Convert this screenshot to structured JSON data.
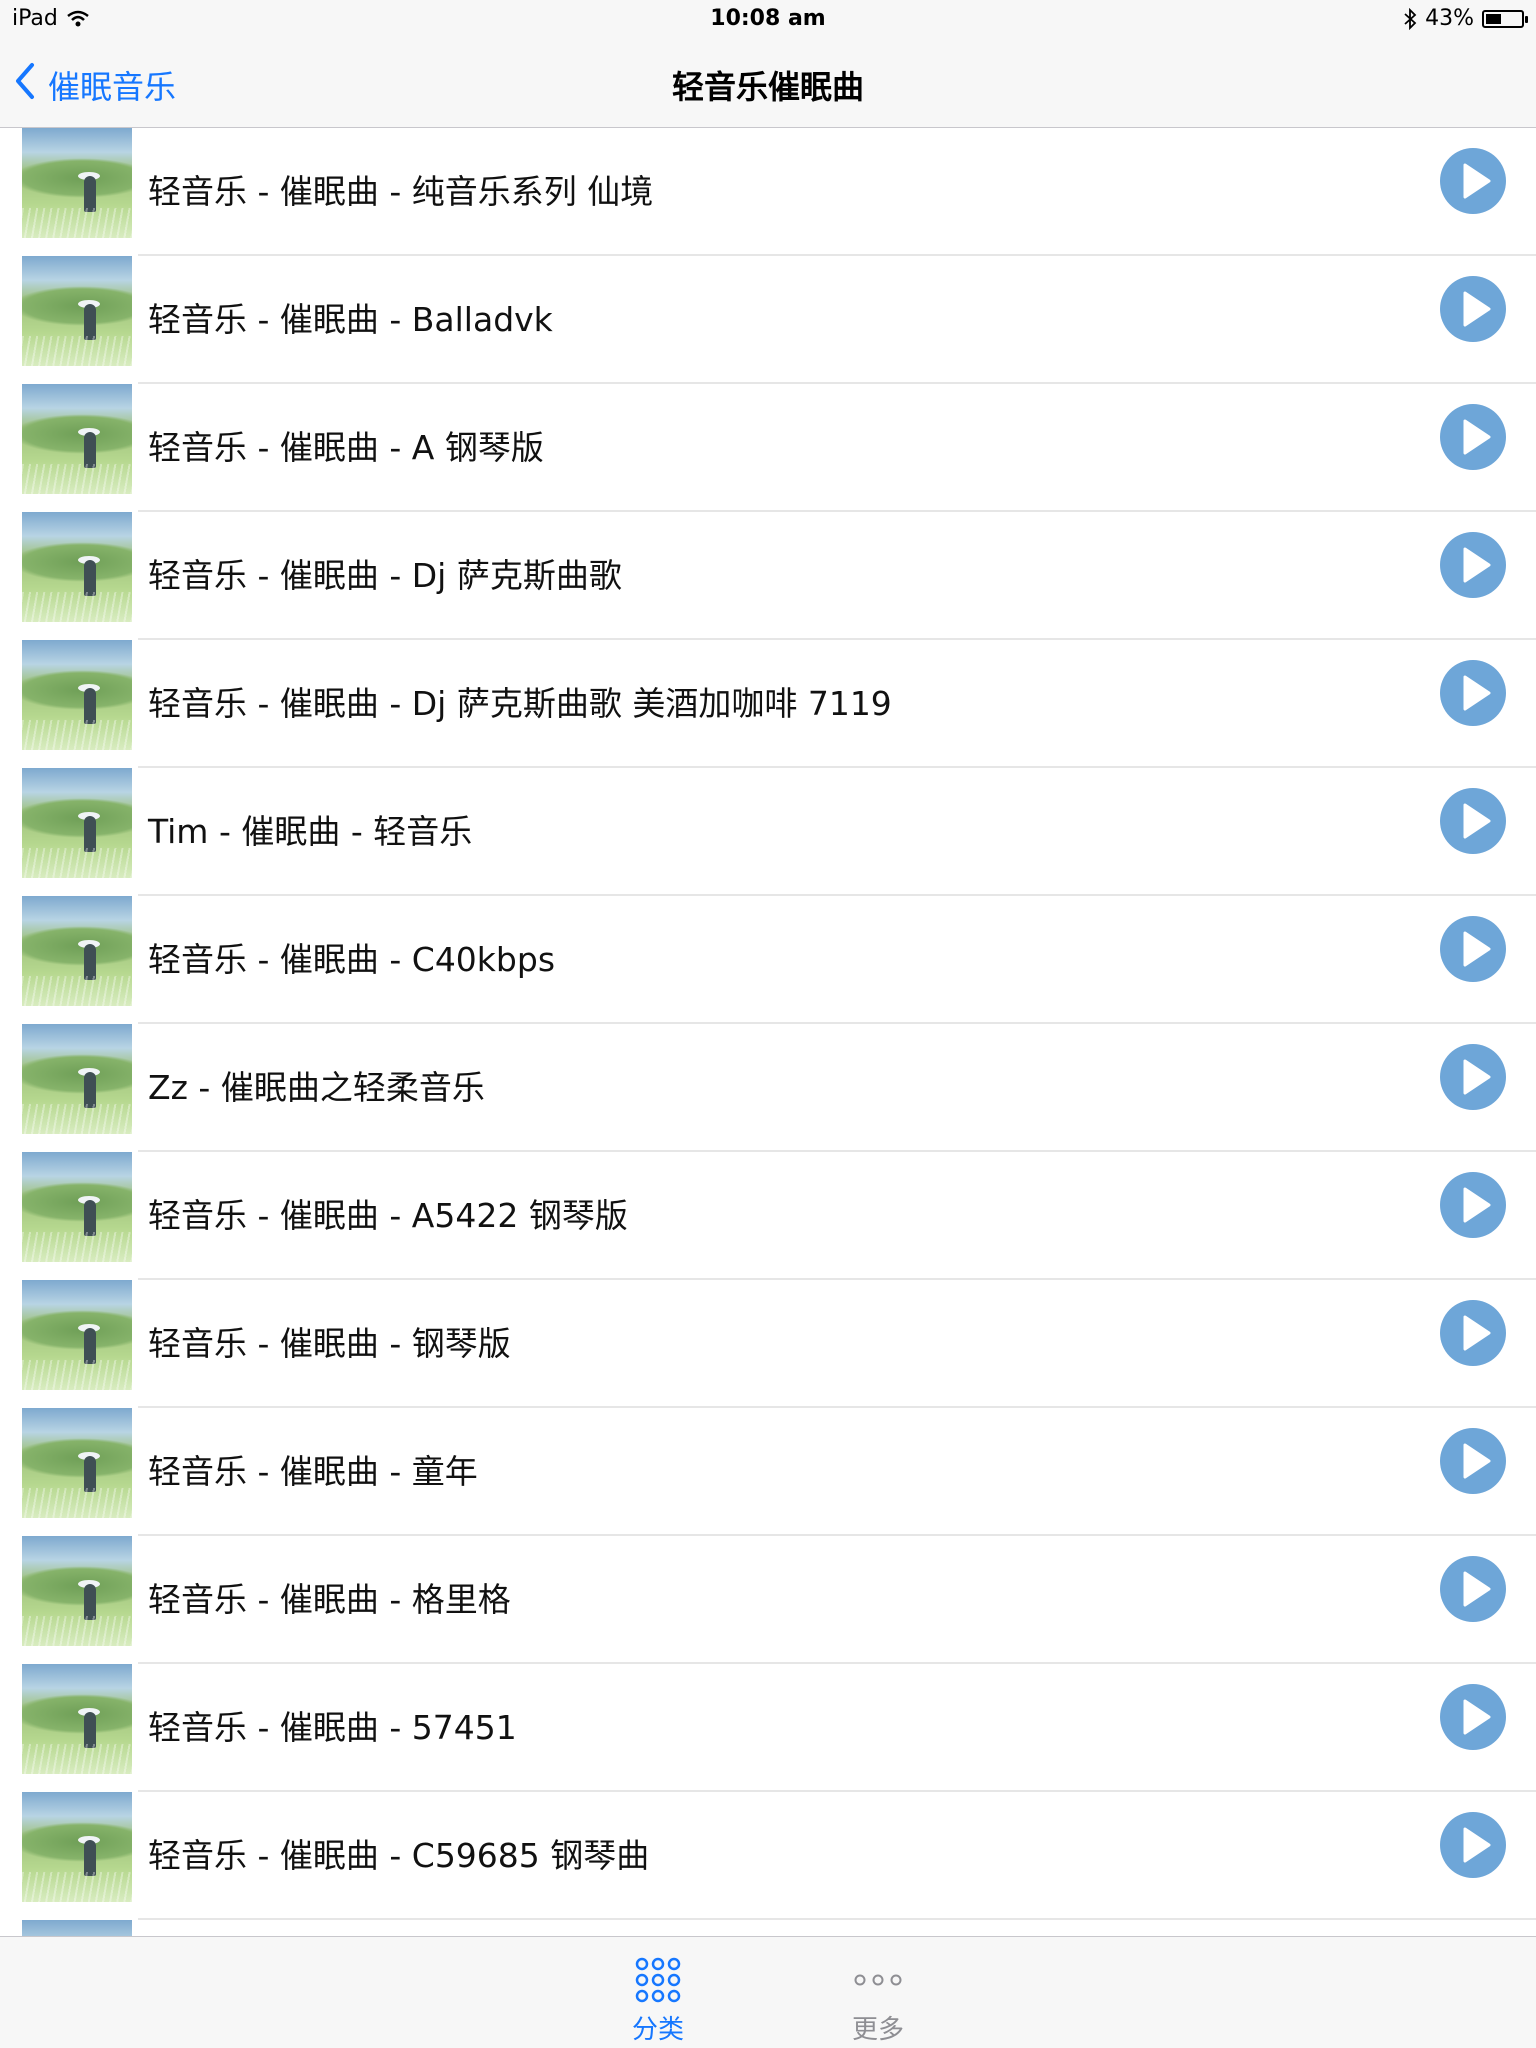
{
  "status_bar": {
    "device": "iPad",
    "time": "10:08 am",
    "battery": "43%",
    "battery_level": 0.43
  },
  "nav": {
    "back_label": "催眠音乐",
    "title": "轻音乐催眠曲"
  },
  "tracks": [
    {
      "title": "轻音乐 - 催眠曲 - 纯音乐系列 仙境"
    },
    {
      "title": "轻音乐 - 催眠曲 - Balladvk"
    },
    {
      "title": "轻音乐 - 催眠曲 - A 钢琴版"
    },
    {
      "title": "轻音乐 - 催眠曲 - Dj 萨克斯曲歌"
    },
    {
      "title": "轻音乐 - 催眠曲 - Dj 萨克斯曲歌 美酒加咖啡 7119"
    },
    {
      "title": "Tim - 催眠曲 - 轻音乐"
    },
    {
      "title": "轻音乐 - 催眠曲 - C40kbps"
    },
    {
      "title": "Zz - 催眠曲之轻柔音乐"
    },
    {
      "title": "轻音乐 - 催眠曲 - A5422 钢琴版"
    },
    {
      "title": "轻音乐 - 催眠曲 - 钢琴版"
    },
    {
      "title": "轻音乐 - 催眠曲 - 童年"
    },
    {
      "title": "轻音乐 - 催眠曲 - 格里格"
    },
    {
      "title": "轻音乐 - 催眠曲 - 57451"
    },
    {
      "title": "轻音乐 - 催眠曲 - C59685 钢琴曲"
    },
    {
      "title": ""
    }
  ],
  "tab_bar": {
    "category_label": "分类",
    "more_label": "更多"
  },
  "colors": {
    "accent": "#1677ff",
    "play_button": "#6ea6d8",
    "inactive_tab": "#8e8e93"
  },
  "icons": {
    "back": "chevron-left-icon",
    "play": "play-icon",
    "category": "grid-dots-icon",
    "more": "more-dots-icon",
    "wifi": "wifi-icon",
    "bluetooth": "bluetooth-icon",
    "battery": "battery-icon"
  }
}
